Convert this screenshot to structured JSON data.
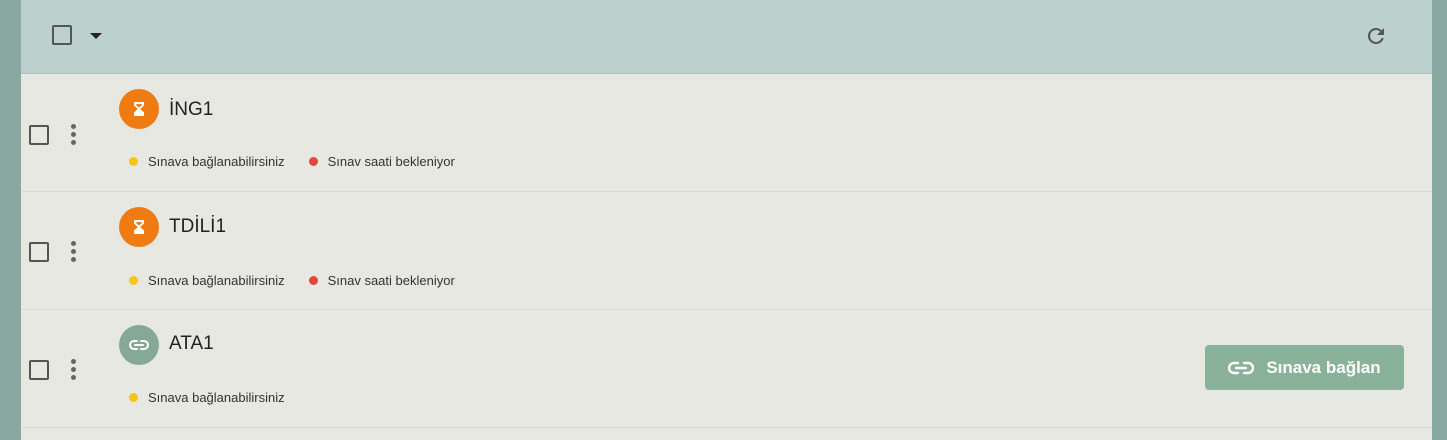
{
  "toolbar": {
    "select_all_icon": "checkbox-icon",
    "dropdown_icon": "caret-down-icon",
    "refresh_icon": "refresh-icon"
  },
  "colors": {
    "toolbar_bg": "#bcd0ce",
    "panel_bg": "#e8e8e3",
    "pending_orange": "#f07b12",
    "link_green": "#86a896",
    "dot_yellow": "#f5c518",
    "dot_red": "#e8453c",
    "button_green": "#8ab29a"
  },
  "exams": [
    {
      "title": "İNG1",
      "status_icon": "hourglass-icon",
      "tags": [
        {
          "label": "Sınava bağlanabilirsiniz",
          "color": "yellow"
        },
        {
          "label": "Sınav saati bekleniyor",
          "color": "red"
        }
      ]
    },
    {
      "title": "TDİLİ1",
      "status_icon": "hourglass-icon",
      "tags": [
        {
          "label": "Sınava bağlanabilirsiniz",
          "color": "yellow"
        },
        {
          "label": "Sınav saati bekleniyor",
          "color": "red"
        }
      ]
    },
    {
      "title": "ATA1",
      "status_icon": "link-icon",
      "tags": [
        {
          "label": "Sınava bağlanabilirsiniz",
          "color": "yellow"
        }
      ],
      "action_label": "Sınava bağlan"
    }
  ]
}
